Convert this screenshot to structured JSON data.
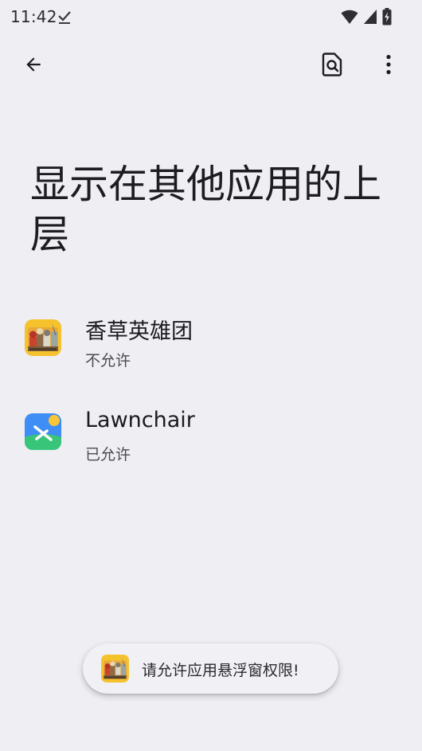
{
  "status_bar": {
    "time": "11:42",
    "icons": [
      "check-icon",
      "wifi-icon",
      "signal-icon",
      "battery-charging-icon"
    ]
  },
  "app_bar": {
    "icons": [
      "back-arrow-icon",
      "search-settings-icon",
      "more-vert-icon"
    ]
  },
  "page": {
    "title": "显示在其他应用的上层"
  },
  "apps": [
    {
      "name": "香草英雄团",
      "status": "不允许",
      "icon": "vanilla-heroes-app-icon"
    },
    {
      "name": "Lawnchair",
      "status": "已允许",
      "icon": "lawnchair-app-icon"
    }
  ],
  "toast": {
    "message": "请允许应用悬浮窗权限!",
    "icon": "vanilla-heroes-app-icon"
  },
  "colors": {
    "background": "#eeeef3",
    "text_primary": "#1c1c1f",
    "text_secondary": "#4a4a50",
    "toast_background": "#f1f1f5"
  }
}
